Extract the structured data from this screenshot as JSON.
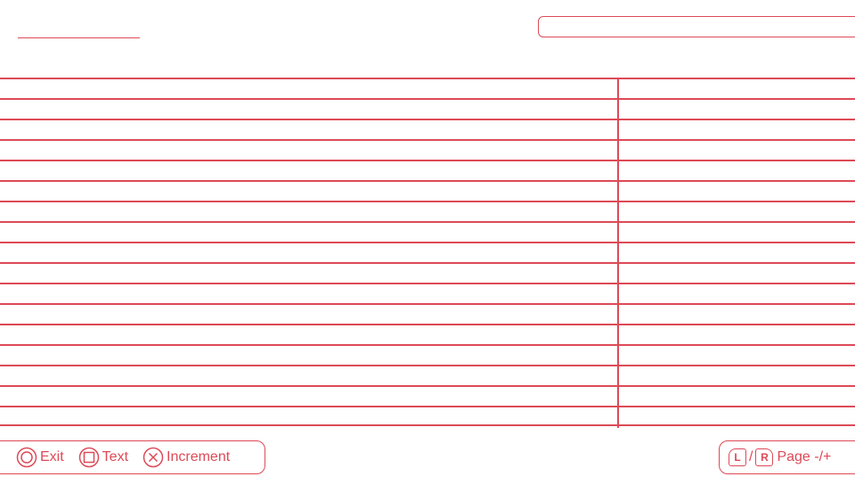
{
  "colors": {
    "accent": "#dd4a57",
    "background": "#ffffff"
  },
  "header": {
    "title": "",
    "search_value": ""
  },
  "table": {
    "rows": [
      {
        "name": "",
        "value": ""
      },
      {
        "name": "",
        "value": ""
      },
      {
        "name": "",
        "value": ""
      },
      {
        "name": "",
        "value": ""
      },
      {
        "name": "",
        "value": ""
      },
      {
        "name": "",
        "value": ""
      },
      {
        "name": "",
        "value": ""
      },
      {
        "name": "",
        "value": ""
      },
      {
        "name": "",
        "value": ""
      },
      {
        "name": "",
        "value": ""
      },
      {
        "name": "",
        "value": ""
      },
      {
        "name": "",
        "value": ""
      },
      {
        "name": "",
        "value": ""
      },
      {
        "name": "",
        "value": ""
      },
      {
        "name": "",
        "value": ""
      },
      {
        "name": "",
        "value": ""
      },
      {
        "name": "",
        "value": ""
      }
    ]
  },
  "footer": {
    "hints": [
      {
        "icon": "circle-button-icon",
        "label": "Exit"
      },
      {
        "icon": "square-button-icon",
        "label": "Text"
      },
      {
        "icon": "cross-button-icon",
        "label": "Increment"
      }
    ],
    "page_hint": {
      "left_button": "L",
      "separator": "/",
      "right_button": "R",
      "label": "Page -/+"
    }
  }
}
